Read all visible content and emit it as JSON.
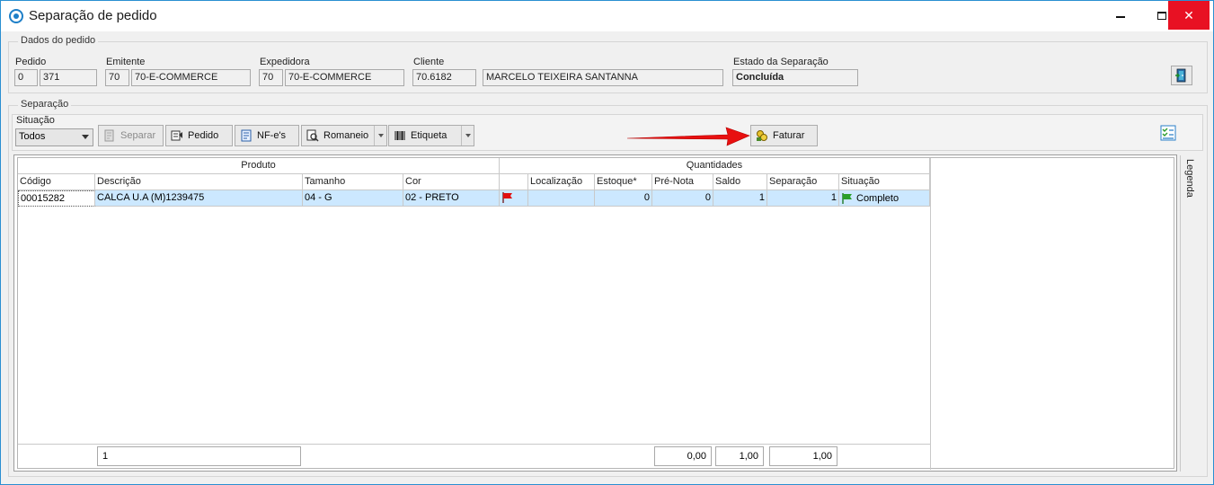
{
  "window": {
    "title": "Separação de pedido"
  },
  "dados": {
    "group_title": "Dados do pedido",
    "pedido_label": "Pedido",
    "pedido_a": "0",
    "pedido_b": "371",
    "emitente_label": "Emitente",
    "emitente_code": "70",
    "emitente_name": "70-E-COMMERCE",
    "expedidora_label": "Expedidora",
    "expedidora_code": "70",
    "expedidora_name": "70-E-COMMERCE",
    "cliente_label": "Cliente",
    "cliente_code": "70.6182",
    "cliente_name": "MARCELO TEIXEIRA SANTANNA",
    "estado_label": "Estado da Separação",
    "estado_value": "Concluída"
  },
  "separacao": {
    "group_title": "Separação",
    "situacao_label": "Situação",
    "situacao_value": "Todos",
    "buttons": {
      "separar": "Separar",
      "pedido": "Pedido",
      "nfes": "NF-e's",
      "romaneio": "Romaneio",
      "etiqueta": "Etiqueta",
      "faturar": "Faturar"
    }
  },
  "grid": {
    "group_produto": "Produto",
    "group_quantidades": "Quantidades",
    "columns": [
      "Código",
      "Descrição",
      "Tamanho",
      "Cor",
      "",
      "Localização",
      "Estoque*",
      "Pré-Nota",
      "Saldo",
      "Separação",
      "Situação"
    ],
    "row": {
      "codigo": "00015282",
      "descricao": "CALCA U.A (M)1239475",
      "tamanho": "04 - G",
      "cor": "02 - PRETO",
      "localizacao": "",
      "estoque": "0",
      "pre_nota": "0",
      "saldo": "1",
      "separacao": "1",
      "situacao": "Completo"
    },
    "footer": {
      "count": "1",
      "pre_nota_total": "0,00",
      "saldo_total": "1,00",
      "separacao_total": "1,00"
    }
  },
  "legenda": "Legenda",
  "colors": {
    "accent": "#1e7fc8",
    "close": "#e81123",
    "selection": "#cce8ff",
    "arrow": "#e81010"
  }
}
